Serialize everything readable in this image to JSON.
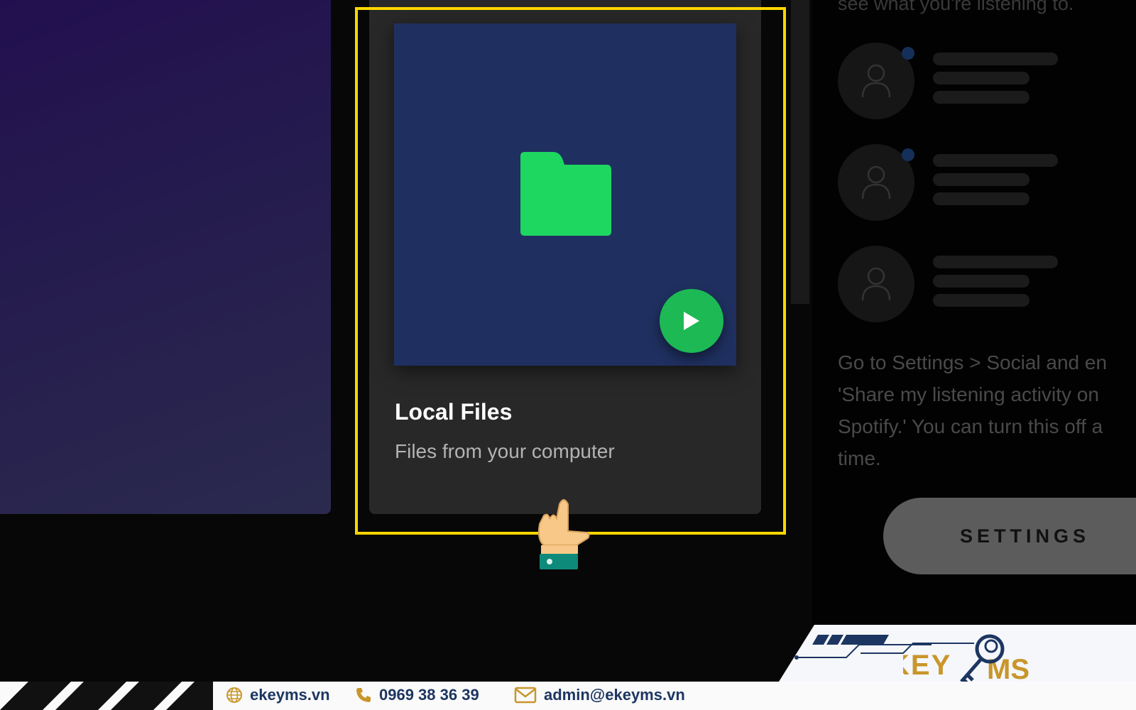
{
  "card": {
    "title": "Local Files",
    "subtitle": "Files from your computer"
  },
  "right_panel": {
    "heading": "see what you're listening to.",
    "body": "Go to Settings > Social and en\n'Share my listening activity on\nSpotify.' You can turn this off a\ntime.",
    "settings_label": "SETTINGS"
  },
  "footer": {
    "website": "ekeyms.vn",
    "phone": "0969 38 36 39",
    "email": "admin@ekeyms.vn",
    "logo_text": "KEYMS"
  },
  "colors": {
    "accent": "#1db954",
    "cover": "#1f3060",
    "highlight": "#ffd600",
    "brand_navy": "#1d3661",
    "brand_gold": "#c9962a"
  },
  "icons": [
    "folder-icon",
    "play-icon",
    "user-icon",
    "hand-pointer-icon",
    "globe-icon",
    "phone-icon",
    "mail-icon"
  ]
}
